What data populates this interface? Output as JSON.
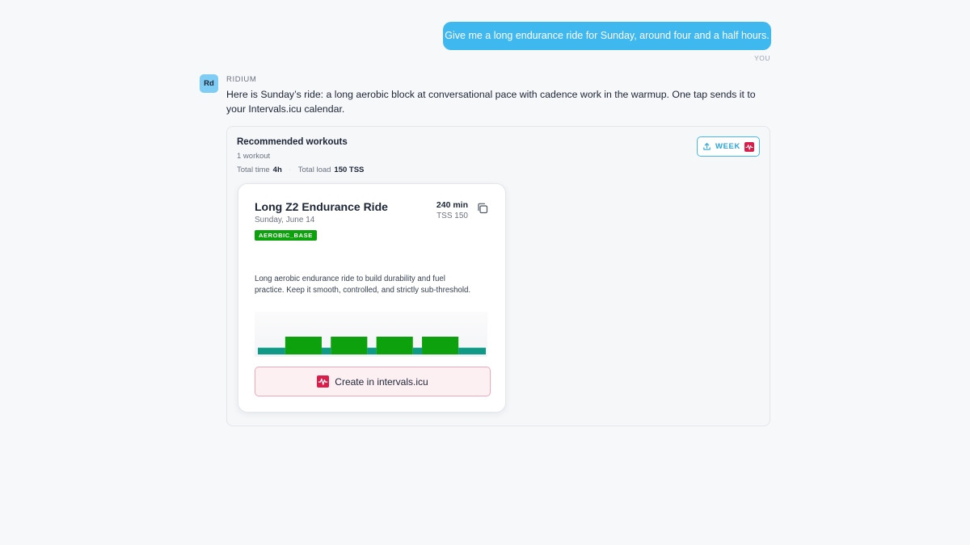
{
  "user_message": {
    "text": "Give me a long endurance ride for Sunday, around four and a half hours.",
    "sender_label": "YOU"
  },
  "assistant": {
    "avatar_initials": "Rd",
    "sender_label": "RIDIUM",
    "text": "Here is Sunday’s ride: a long aerobic block at conversational pace with cadence work in the warmup. One tap sends it to your Intervals.icu calendar."
  },
  "recommendations": {
    "title": "Recommended workouts",
    "count_text": "1 workout",
    "total_time_label": "Total time",
    "total_time_value": "4h",
    "total_load_label": "Total load",
    "total_load_value": "150 TSS",
    "week_button_label": "WEEK",
    "workouts": [
      {
        "title": "Long Z2 Endurance Ride",
        "date": "Sunday, June 14",
        "badge": "AEROBIC_BASE",
        "duration": "240 min",
        "tss": "TSS 150",
        "description": "Long aerobic endurance ride to build durability and fuel practice. Keep it smooth, controlled, and strictly sub-threshold.",
        "create_button_label": "Create in intervals.icu"
      }
    ]
  },
  "workout_profile": {
    "base_color": "#0e9a86",
    "block_color": "#0ea10e",
    "base_level": 0.38,
    "block_level": 1.0,
    "segments": [
      {
        "type": "base",
        "start": 0.0,
        "end": 0.12
      },
      {
        "type": "block",
        "start": 0.12,
        "end": 0.28
      },
      {
        "type": "base",
        "start": 0.28,
        "end": 0.32
      },
      {
        "type": "block",
        "start": 0.32,
        "end": 0.48
      },
      {
        "type": "base",
        "start": 0.48,
        "end": 0.52
      },
      {
        "type": "block",
        "start": 0.52,
        "end": 0.68
      },
      {
        "type": "base",
        "start": 0.68,
        "end": 0.72
      },
      {
        "type": "block",
        "start": 0.72,
        "end": 0.88
      },
      {
        "type": "base",
        "start": 0.88,
        "end": 1.0
      }
    ]
  },
  "colors": {
    "user_bubble": "#3fb8f0",
    "intervals_brand": "#d81e4a",
    "badge": "#0ea10e",
    "week_accent": "#2aa6db"
  },
  "icons": {
    "copy": "copy-icon",
    "upload": "upload-icon",
    "intervals": "intervals-logo-icon"
  }
}
